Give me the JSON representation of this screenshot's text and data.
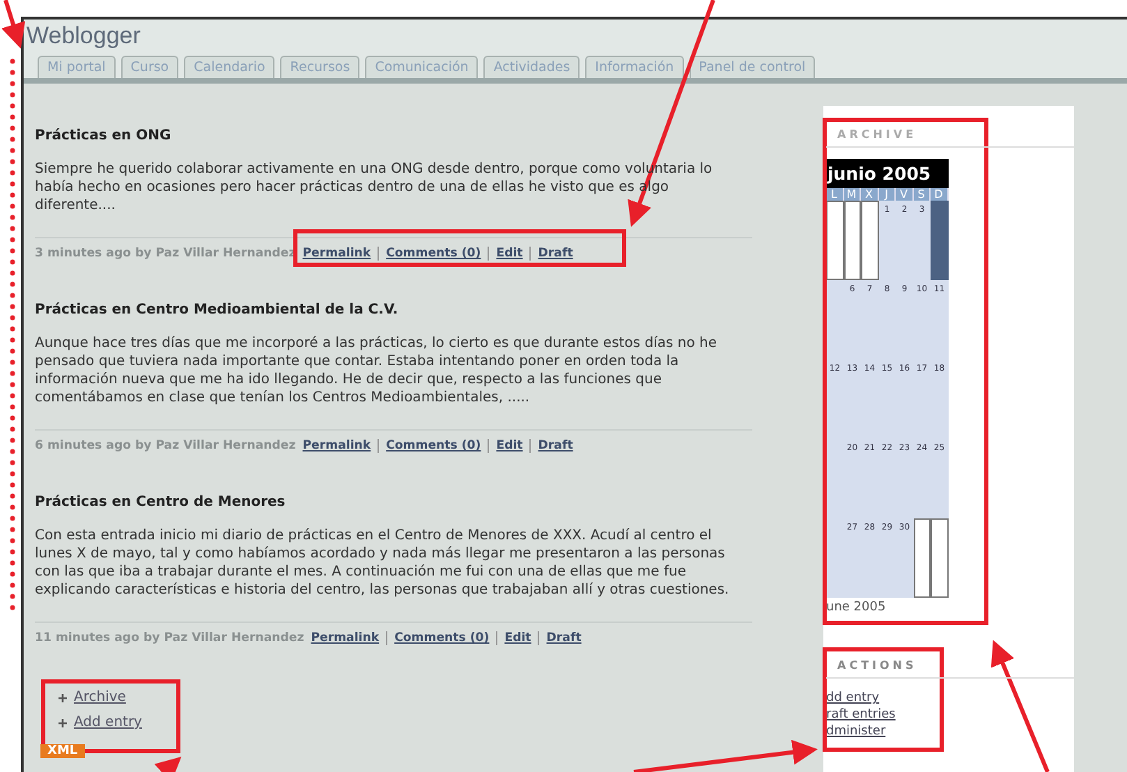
{
  "window": {
    "title": "Weblogger"
  },
  "tabs": [
    {
      "label": "Mi portal",
      "selected": false
    },
    {
      "label": "Curso",
      "selected": false
    },
    {
      "label": "Calendario",
      "selected": false
    },
    {
      "label": "Recursos",
      "selected": false
    },
    {
      "label": "Comunicación",
      "selected": false
    },
    {
      "label": "Actividades",
      "selected": false
    },
    {
      "label": "Información",
      "selected": false
    },
    {
      "label": "Panel de control",
      "selected": false
    }
  ],
  "posts": [
    {
      "title": "Prácticas en ONG",
      "body": "Siempre he querido colaborar activamente en una ONG desde dentro, porque como voluntaria lo había hecho en ocasiones pero hacer prácticas dentro de una de ellas he visto que es algo diferente....",
      "meta": "3 minutes ago by Paz Villar Hernandez",
      "links": [
        "Permalink",
        "Comments (0)",
        "Edit",
        "Draft"
      ]
    },
    {
      "title": "Prácticas en Centro Medioambiental de la C.V.",
      "body": "Aunque hace tres días que me incorporé a las prácticas, lo cierto es que durante estos días no he pensado que tuviera nada importante que contar. Estaba intentando poner en orden toda la información nueva que me ha ido llegando. He de decir que, respecto a las funciones que comentábamos en clase que tenían los Centros Medioambientales, .....",
      "meta": "6 minutes ago by Paz Villar Hernandez",
      "links": [
        "Permalink",
        "Comments (0)",
        "Edit",
        "Draft"
      ]
    },
    {
      "title": "Prácticas en Centro de Menores",
      "body": "Con esta entrada inicio mi diario de prácticas en el Centro de Menores de XXX. Acudí al centro el lunes X de mayo, tal y como habíamos acordado y nada más llegar me presentaron a las personas con las que iba a trabajar durante el mes. A continuación me fui con una de ellas que me fue explicando características e historia del centro, las personas que trabajaban allí y otras cuestiones.",
      "meta": "11 minutes ago by Paz Villar Hernandez",
      "links": [
        "Permalink",
        "Comments (0)",
        "Edit",
        "Draft"
      ]
    }
  ],
  "footer_links": [
    "Archive",
    "Add entry"
  ],
  "xml_badge": "XML",
  "archive": {
    "heading": "ARCHIVE",
    "month": "junio 2005",
    "weekdays": [
      "L",
      "M",
      "X",
      "J",
      "V",
      "S",
      "D"
    ],
    "weeks": [
      [
        {
          "kind": "blank"
        },
        {
          "kind": "blank"
        },
        {
          "kind": "blank"
        },
        {
          "kind": "day",
          "text": "1"
        },
        {
          "kind": "day",
          "text": "2"
        },
        {
          "kind": "day",
          "text": "3"
        },
        {
          "kind": "shaded"
        }
      ],
      [
        {
          "kind": "day"
        },
        {
          "kind": "day",
          "text": "6"
        },
        {
          "kind": "day",
          "text": "7"
        },
        {
          "kind": "day",
          "text": "8"
        },
        {
          "kind": "day",
          "text": "9"
        },
        {
          "kind": "day",
          "text": "10"
        },
        {
          "kind": "day",
          "text": "11"
        }
      ],
      [
        {
          "kind": "day",
          "text": "12"
        },
        {
          "kind": "day",
          "text": "13"
        },
        {
          "kind": "day",
          "text": "14"
        },
        {
          "kind": "day",
          "text": "15"
        },
        {
          "kind": "day",
          "text": "16"
        },
        {
          "kind": "day",
          "text": "17"
        },
        {
          "kind": "day",
          "text": "18"
        }
      ],
      [
        {
          "kind": "day"
        },
        {
          "kind": "day",
          "text": "20"
        },
        {
          "kind": "day",
          "text": "21"
        },
        {
          "kind": "day",
          "text": "22"
        },
        {
          "kind": "day",
          "text": "23"
        },
        {
          "kind": "day",
          "text": "24"
        },
        {
          "kind": "day",
          "text": "25"
        }
      ],
      [
        {
          "kind": "day"
        },
        {
          "kind": "day",
          "text": "27"
        },
        {
          "kind": "day",
          "text": "28"
        },
        {
          "kind": "day",
          "text": "29"
        },
        {
          "kind": "day",
          "text": "30"
        },
        {
          "kind": "blank"
        },
        {
          "kind": "blank"
        }
      ]
    ],
    "footer": "une 2005"
  },
  "actions": {
    "heading": "ACTIONS",
    "links": [
      "dd entry",
      "raft entries",
      "dminister"
    ]
  }
}
